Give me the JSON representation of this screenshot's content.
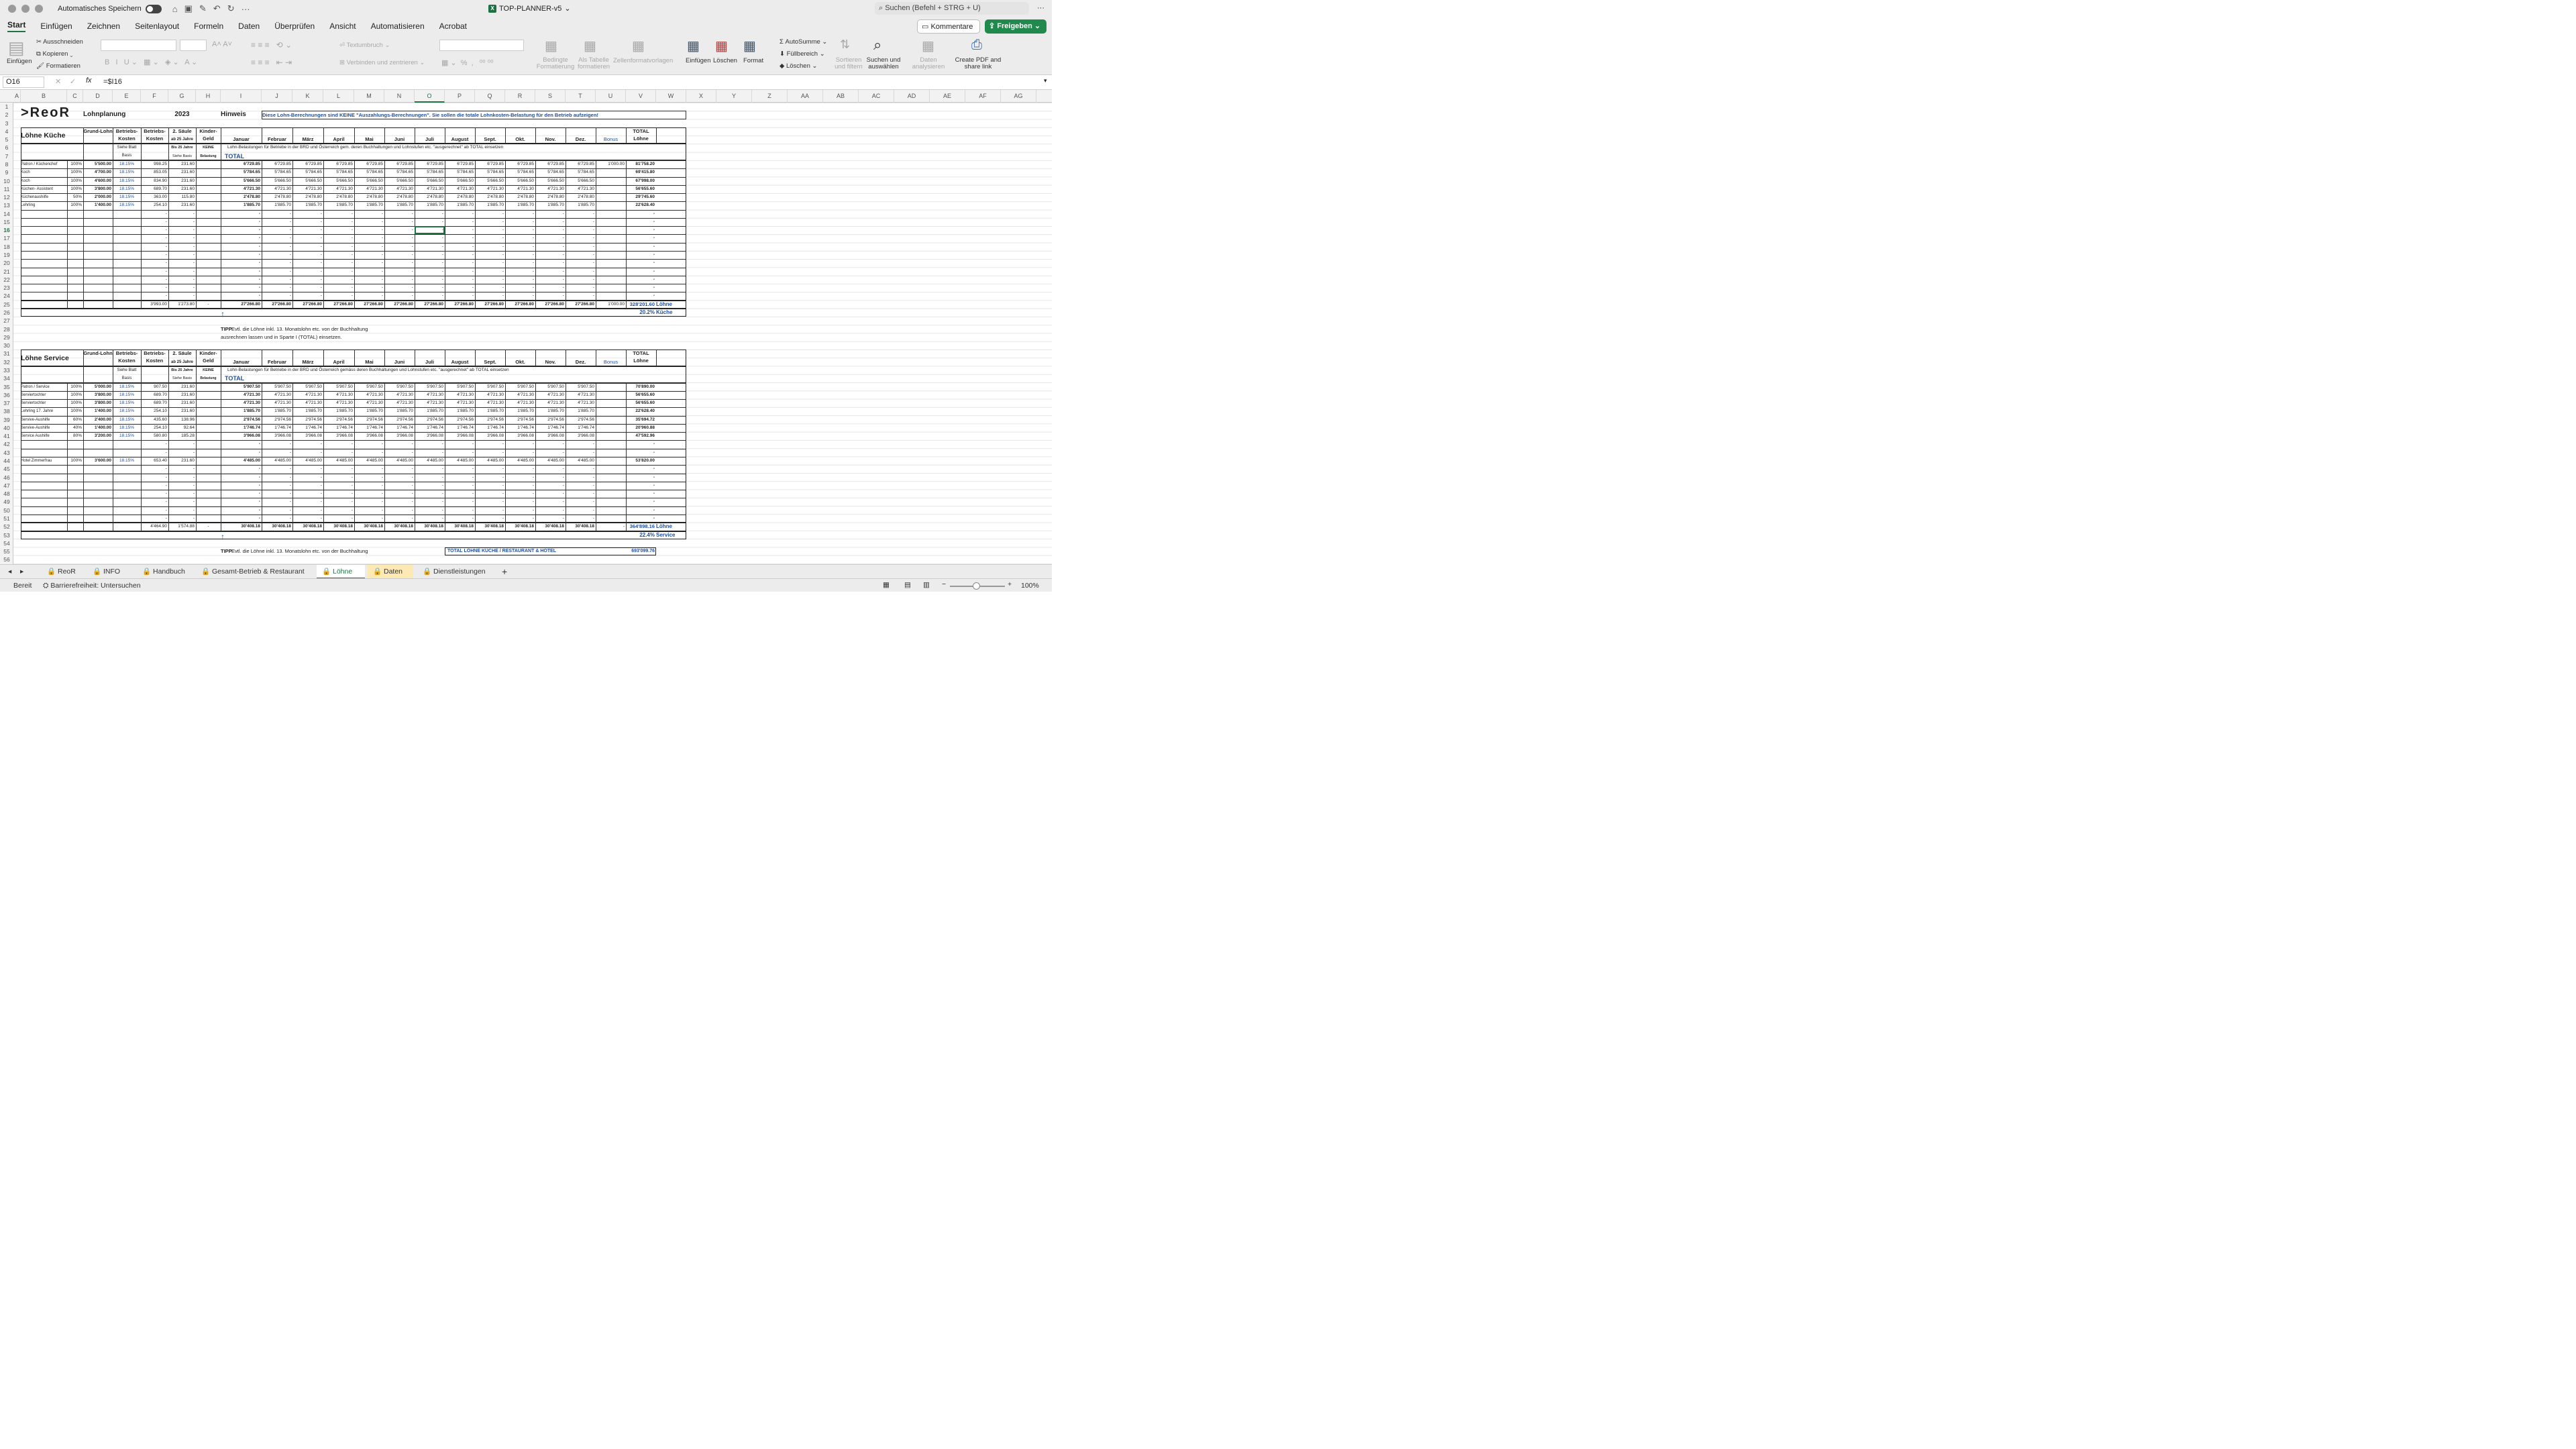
{
  "titlebar": {
    "autosave": "Automatisches Speichern",
    "doc": "TOP-PLANNER-v5",
    "search": "Suchen (Befehl + STRG + U)"
  },
  "menu": [
    "Start",
    "Einfügen",
    "Zeichnen",
    "Seitenlayout",
    "Formeln",
    "Daten",
    "Überprüfen",
    "Ansicht",
    "Automatisieren",
    "Acrobat"
  ],
  "buttons": {
    "kommentare": "Kommentare",
    "freigeben": "Freigeben"
  },
  "ribbon": {
    "einfuegen": "Einfügen",
    "ausschneiden": "Ausschneiden",
    "kopieren": "Kopieren",
    "formatieren": "Formatieren",
    "textumbruch": "Textumbruch",
    "verbinden": "Verbinden und zentrieren",
    "bedingte": "Bedingte Formatierung",
    "tabelle": "Als Tabelle formatieren",
    "zellformat": "Zellenformatvorlagen",
    "z_einfuegen": "Einfügen",
    "z_loeschen": "Löschen",
    "format": "Format",
    "autosumme": "AutoSumme",
    "fuellbereich": "Füllbereich",
    "loeschen": "Löschen",
    "sortieren": "Sortieren und filtern",
    "suchen": "Suchen und auswählen",
    "daten": "Daten analysieren",
    "pdf": "Create PDF and share link"
  },
  "formula": {
    "cellref": "O16",
    "formula": "=$I16"
  },
  "columns": [
    "A",
    "B",
    "C",
    "D",
    "E",
    "F",
    "G",
    "H",
    "I",
    "J",
    "K",
    "L",
    "M",
    "N",
    "O",
    "P",
    "Q",
    "R",
    "S",
    "T",
    "U",
    "V",
    "W",
    "X",
    "Y",
    "Z",
    "AA",
    "AB",
    "AC",
    "AD",
    "AE",
    "AF",
    "AG"
  ],
  "sheet": {
    "logo": ">ReoR",
    "lohnplanung": "Lohnplanung",
    "year": "2023",
    "hinweis": "Hinweis",
    "hinweis_text": "Diese Lohn-Berechnungen sind KEINE \"Auszahlungs-Berechnungen\". Sie sollen die totale Lohnkosten-Belastung für den Betrieb aufzeigen!",
    "kueche_title": "Löhne Küche",
    "service_title": "Löhne Service",
    "hdr": {
      "grund": "Grund-Lohn",
      "betrieb1": "Betriebs-Kosten",
      "betrieb2": "Betriebs-Kosten",
      "saeule": "2. Säule",
      "ab25": "ab 25 Jahre",
      "kinder": "Kinder-Geld",
      "bonus": "Bonus",
      "total": "TOTAL Löhne",
      "siehe": "Siehe Blatt Basis",
      "bis25": "Bis 25 Jahre",
      "siehe_basis": "Siehe Basis",
      "keine": "KEINE",
      "belastung": "Belastung",
      "total_lbl": "TOTAL"
    },
    "months": [
      "Januar",
      "Februar",
      "März",
      "April",
      "Mai",
      "Juni",
      "Juli",
      "August",
      "Sept.",
      "Okt.",
      "Nov.",
      "Dez."
    ],
    "note_k": "Lohn-Belastungen für Betriebe in der BRD und Österreich gem. deren Buchhaltungen und Lohnstufen etc. \"ausgerechnet\" ab TOTAL einsetzen",
    "note_s": "Lohn-Belastungen für Betriebe in der BRD und Österreich gemäss deren Buchhaltungen und Lohnstufen etc. \"ausgerechnet\" ab TOTAL einsetzen",
    "kueche_rows": [
      {
        "n": "Patron / Küchenchef",
        "p": "100%",
        "g": "5'500.00",
        "e": "18.15%",
        "f": "998.25",
        "s": "231.60",
        "m": "6'729.85",
        "bonus": "1'000.00",
        "t": "81'758.20"
      },
      {
        "n": "Koch",
        "p": "100%",
        "g": "4'700.00",
        "e": "18.15%",
        "f": "853.05",
        "s": "231.60",
        "m": "5'784.65",
        "bonus": "",
        "t": "69'415.80"
      },
      {
        "n": "Koch",
        "p": "100%",
        "g": "4'600.00",
        "e": "18.15%",
        "f": "834.90",
        "s": "231.60",
        "m": "5'666.50",
        "bonus": "",
        "t": "67'998.00"
      },
      {
        "n": "Küchen- Assistent",
        "p": "100%",
        "g": "3'800.00",
        "e": "18.15%",
        "f": "689.70",
        "s": "231.60",
        "m": "4'721.30",
        "bonus": "",
        "t": "56'655.60"
      },
      {
        "n": "Küchenaushilfe",
        "p": "50%",
        "g": "2'000.00",
        "e": "18.15%",
        "f": "363.00",
        "s": "115.80",
        "m": "2'478.80",
        "bonus": "",
        "t": "29'745.60"
      },
      {
        "n": "Lehrling",
        "p": "100%",
        "g": "1'400.00",
        "e": "18.15%",
        "f": "254.10",
        "s": "231.60",
        "m": "1'885.70",
        "bonus": "",
        "t": "22'628.40"
      }
    ],
    "kueche_sum": {
      "f": "3'993.00",
      "s": "1'273.80",
      "h": "-",
      "m": "27'266.80",
      "bonus": "1'000.00",
      "t": "328'201.60",
      "lbl": "Löhne",
      "pct": "20.2%",
      "lbl2": "Küche"
    },
    "tipp1": "TIPP",
    "tipp2": "Evtl. die Löhne inkl. 13. Monatslohn etc. von der Buchhaltung",
    "tipp3": "ausrechnen lassen und in Sparte I (TOTAL) einsetzen.",
    "service_rows": [
      {
        "n": "Patron / Service",
        "p": "100%",
        "g": "5'000.00",
        "e": "18.15%",
        "f": "907.50",
        "s": "231.60",
        "m": "5'907.50",
        "t": "70'890.00"
      },
      {
        "n": "Serviertochter",
        "p": "100%",
        "g": "3'800.00",
        "e": "18.15%",
        "f": "689.70",
        "s": "231.60",
        "m": "4'721.30",
        "t": "56'655.60"
      },
      {
        "n": "Serviertochter",
        "p": "100%",
        "g": "3'800.00",
        "e": "18.15%",
        "f": "689.70",
        "s": "231.60",
        "m": "4'721.30",
        "t": "56'655.60"
      },
      {
        "n": "Lehrling 17. Jahre",
        "p": "100%",
        "g": "1'400.00",
        "e": "18.15%",
        "f": "254.10",
        "s": "231.60",
        "m": "1'885.70",
        "t": "22'628.40"
      },
      {
        "n": "Servive-Aushilfe",
        "p": "60%",
        "g": "2'400.00",
        "e": "18.15%",
        "f": "435.60",
        "s": "138.96",
        "m": "2'974.56",
        "t": "35'694.72"
      },
      {
        "n": "Servive-Aushilfe",
        "p": "40%",
        "g": "1'400.00",
        "e": "18.15%",
        "f": "254.10",
        "s": "92.64",
        "m": "1'746.74",
        "t": "20'960.88"
      },
      {
        "n": "Service Aushilfe",
        "p": "80%",
        "g": "3'200.00",
        "e": "18.15%",
        "f": "580.80",
        "s": "185.28",
        "m": "3'966.08",
        "t": "47'592.96"
      }
    ],
    "hotel_row": {
      "n": "Hotel Zimmerfrau",
      "p": "100%",
      "g": "3'600.00",
      "e": "18.15%",
      "f": "653.40",
      "s": "231.60",
      "m": "4'485.00",
      "t": "53'820.00"
    },
    "service_sum": {
      "f": "4'464.90",
      "s": "1'574.88",
      "h": "-",
      "m": "30'408.18",
      "bonus": "-",
      "t": "364'898.16",
      "lbl": "Löhne",
      "pct": "22.4%",
      "lbl2": "Service"
    },
    "grand_label": "TOTAL LÖHNE KÜCHE / RESTAURANT & HOTEL",
    "grand": "693'099.76"
  },
  "tabs": [
    "ReoR",
    "INFO",
    "Handbuch",
    "Gesamt-Betrieb & Restaurant",
    "Löhne",
    "Daten",
    "Dienstleistungen"
  ],
  "status": {
    "ready": "Bereit",
    "access": "Barrierefreiheit: Untersuchen",
    "zoom": "100%"
  }
}
